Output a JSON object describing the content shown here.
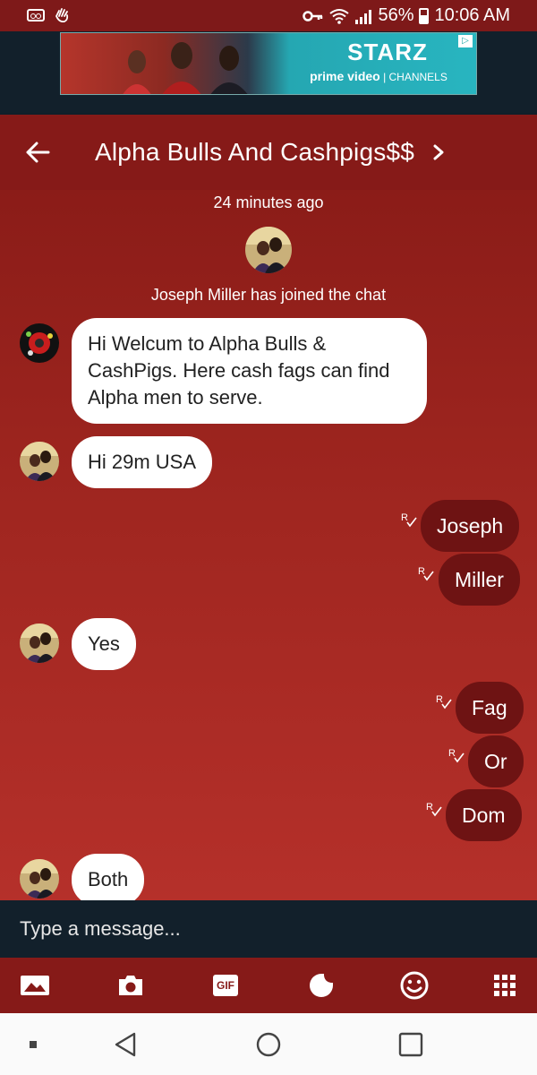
{
  "status_bar": {
    "battery": "56%",
    "time": "10:06 AM",
    "icons": [
      "voicemail-icon",
      "hand-icon",
      "key-icon",
      "wifi-icon",
      "signal-icon",
      "battery-icon"
    ]
  },
  "ad": {
    "brand": "STARZ",
    "sub_bold": "prime video",
    "sub_rest": "| CHANNELS",
    "choice": "▷"
  },
  "header": {
    "title": "Alpha Bulls And Cashpigs$$",
    "chevron": "›",
    "color": "#861a18"
  },
  "chat": {
    "timestamp": "24 minutes ago",
    "join_text": "Joseph Miller has joined the chat",
    "messages": [
      {
        "side": "in",
        "text": "Hi Welcum to Alpha Bulls & CashPigs. Here cash fags can find Alpha men to serve.",
        "avatar": "bot-avatar"
      },
      {
        "side": "in",
        "text": "Hi 29m USA",
        "avatar": "user-avatar"
      },
      {
        "side": "out",
        "text": "Joseph"
      },
      {
        "side": "out",
        "text": "Miller"
      },
      {
        "side": "in",
        "text": "Yes",
        "avatar": "user-avatar"
      },
      {
        "side": "out",
        "text": "Fag"
      },
      {
        "side": "out",
        "text": "Or"
      },
      {
        "side": "out",
        "text": "Dom"
      },
      {
        "side": "in",
        "text": "Both",
        "avatar": "user-avatar"
      }
    ],
    "read_receipt": "R"
  },
  "composer": {
    "placeholder": "Type a message..."
  },
  "toolbar": {
    "gif_label": "GIF",
    "icons": [
      "image-icon",
      "camera-icon",
      "gif-icon",
      "sticker-icon",
      "emoji-icon",
      "grid-icon"
    ]
  },
  "colors": {
    "header": "#861a18",
    "outgoing_bubble": "#6e1313",
    "composer": "#12202b"
  }
}
